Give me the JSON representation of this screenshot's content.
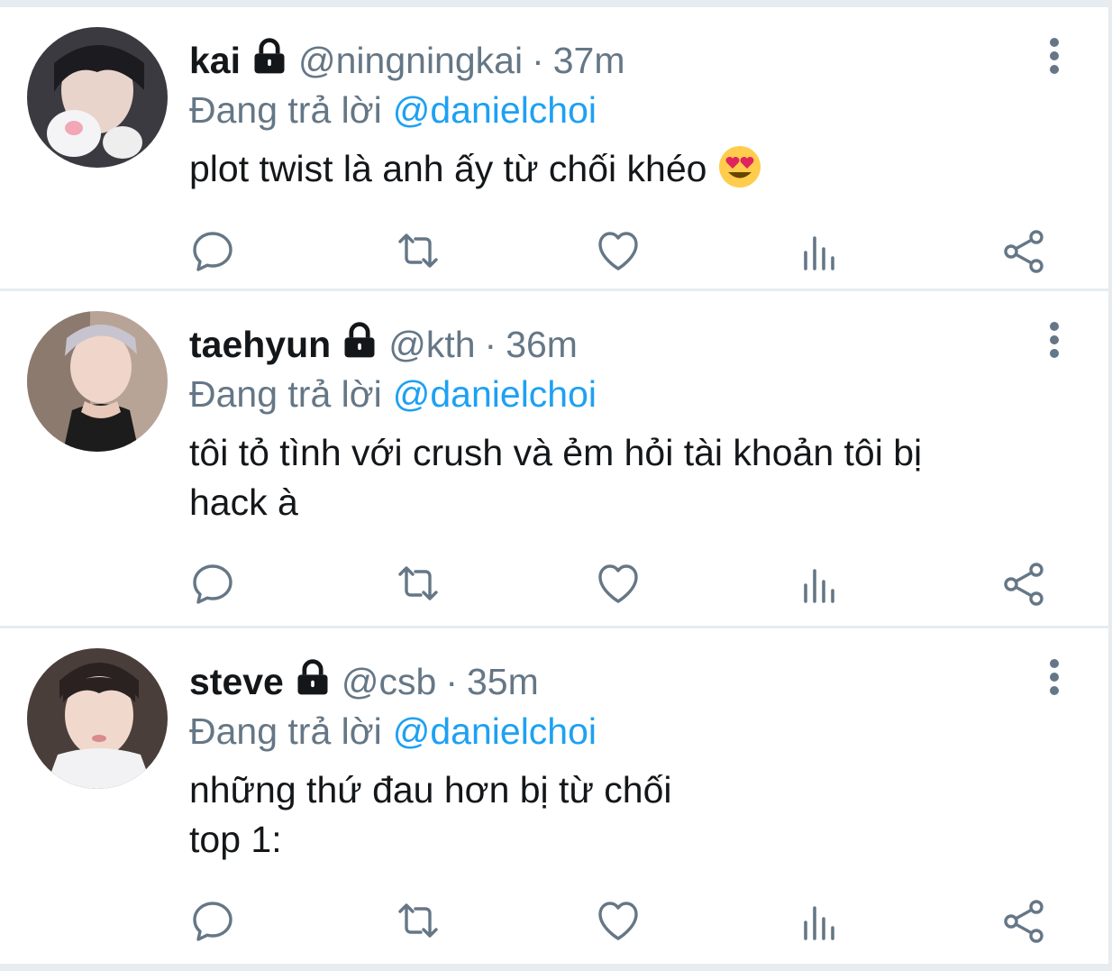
{
  "tweets": [
    {
      "name": "kai",
      "handle": "@ningningkai",
      "separator": "·",
      "time": "37m",
      "reply_prefix": "Đang trả lời",
      "reply_to": "@danielchoi",
      "text": "plot twist là anh ấy từ chối khéo",
      "emoji": "heart-eyes-emoji",
      "avatar_color": "#2d2d33"
    },
    {
      "name": "taehyun",
      "handle": "@kth",
      "separator": "·",
      "time": "36m",
      "reply_prefix": "Đang trả lời",
      "reply_to": "@danielchoi",
      "text": "tôi tỏ tình với crush và ẻm hỏi tài khoản tôi bị\nhack à",
      "avatar_color": "#c9b6a8"
    },
    {
      "name": "steve",
      "handle": "@csb",
      "separator": "·",
      "time": "35m",
      "reply_prefix": "Đang trả lời",
      "reply_to": "@danielchoi",
      "text": "những thứ đau hơn bị từ chối\ntop 1:",
      "avatar_color": "#5a4a44"
    }
  ],
  "icons": {
    "lock": "lock-icon",
    "more": "more-vertical-icon",
    "reply": "reply-icon",
    "retweet": "retweet-icon",
    "like": "heart-icon",
    "views": "analytics-icon",
    "share": "share-icon"
  },
  "colors": {
    "text_primary": "#14171a",
    "text_secondary": "#657786",
    "accent": "#1da1f2",
    "divider": "#e6ecf0"
  }
}
